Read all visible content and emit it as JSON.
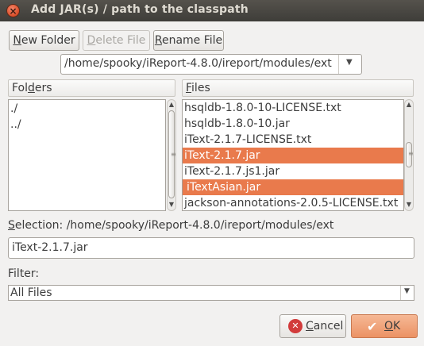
{
  "window": {
    "title": "Add JAR(s) / path to the classpath",
    "close_glyph": "×"
  },
  "toolbar": {
    "new_folder_mnemonic": "N",
    "new_folder_rest": "ew Folder",
    "delete_file_mnemonic": "D",
    "delete_file_rest": "elete File",
    "rename_file_mnemonic": "R",
    "rename_file_rest": "ename File"
  },
  "path_combo": {
    "value": "/home/spooky/iReport-4.8.0/ireport/modules/ext"
  },
  "folders": {
    "header_pre": "Fol",
    "header_mnemonic": "d",
    "header_post": "ers",
    "items": [
      "./",
      "../"
    ]
  },
  "files": {
    "header_mnemonic": "F",
    "header_rest": "iles",
    "items": [
      {
        "name": "hsqldb-1.8.0-10-LICENSE.txt",
        "selected": false
      },
      {
        "name": "hsqldb-1.8.0-10.jar",
        "selected": false
      },
      {
        "name": "iText-2.1.7-LICENSE.txt",
        "selected": false
      },
      {
        "name": "iText-2.1.7.jar",
        "selected": true
      },
      {
        "name": "iText-2.1.7.js1.jar",
        "selected": false
      },
      {
        "name": "iTextAsian.jar",
        "selected": true
      },
      {
        "name": "jackson-annotations-2.0.5-LICENSE.txt",
        "selected": false
      }
    ]
  },
  "selection": {
    "label_mnemonic": "S",
    "label_rest": "election: /home/spooky/iReport-4.8.0/ireport/modules/ext",
    "value": "iText-2.1.7.jar"
  },
  "filter": {
    "label": "Filter:",
    "value": "All Files"
  },
  "buttons": {
    "cancel_mnemonic": "C",
    "cancel_rest": "ancel",
    "ok_mnemonic": "O",
    "ok_rest": "K"
  },
  "icons": {
    "close": "close-icon",
    "cancel": "cancel-icon",
    "ok": "ok-icon",
    "dropdown": "chevron-down-icon",
    "scroll_up": "scroll-up-arrow-icon",
    "scroll_down": "scroll-down-arrow-icon"
  },
  "colors": {
    "selection": "#e97a4c",
    "titlebar": "#3e3d39",
    "ok_button": "#f0a07a",
    "cancel_icon": "#d23b3b"
  }
}
